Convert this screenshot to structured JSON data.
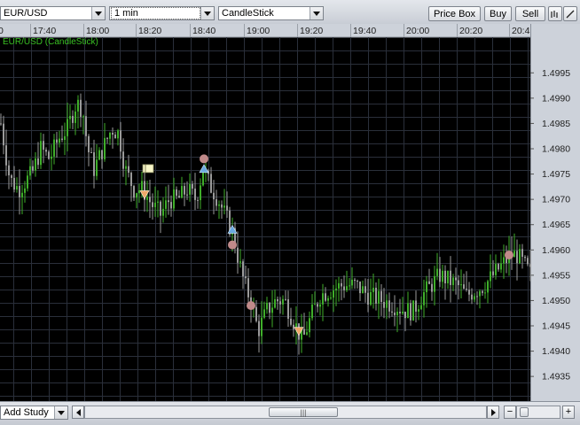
{
  "toolbar": {
    "symbol": "EUR/USD",
    "interval": "1 min",
    "chart_type": "CandleStick",
    "price_box_label": "Price Box",
    "buy_label": "Buy",
    "sell_label": "Sell"
  },
  "chart_title": "EUR/USD (CandleStick)",
  "bottom": {
    "add_study_label": "Add Study",
    "zoom_out_label": "−",
    "zoom_in_label": "+"
  },
  "colors": {
    "background": "#000000",
    "grid": "#2a2f3a",
    "bull": "#3fae2a",
    "bear": "#9a9a9a",
    "title": "#39c023",
    "marker_circle": "#c08a8a",
    "marker_up": "#6aa9e0",
    "marker_down": "#f0a86a",
    "axis_bg": "#cdd2da"
  },
  "chart_data": {
    "type": "candlestick",
    "title": "EUR/USD (CandleStick)",
    "x_ticks": [
      "0",
      "17:40",
      "18:00",
      "18:20",
      "18:40",
      "19:00",
      "19:20",
      "19:40",
      "20:00",
      "20:20",
      "20:4"
    ],
    "y_ticks": [
      "1.4995",
      "1.4990",
      "1.4985",
      "1.4980",
      "1.4975",
      "1.4970",
      "1.4965",
      "1.4960",
      "1.4955",
      "1.4950",
      "1.4945",
      "1.4940",
      "1.4935"
    ],
    "ylim": [
      1.4931,
      1.5001
    ],
    "grid": true,
    "price_path": [
      [
        0,
        1.4985
      ],
      [
        10,
        1.4974
      ],
      [
        20,
        1.4972
      ],
      [
        35,
        1.4975
      ],
      [
        45,
        1.498
      ],
      [
        55,
        1.4978
      ],
      [
        65,
        1.4982
      ],
      [
        75,
        1.4984
      ],
      [
        85,
        1.4989
      ],
      [
        92,
        1.4988
      ],
      [
        98,
        1.498
      ],
      [
        105,
        1.4976
      ],
      [
        115,
        1.498
      ],
      [
        125,
        1.4984
      ],
      [
        133,
        1.4983
      ],
      [
        140,
        1.4976
      ],
      [
        150,
        1.4972
      ],
      [
        160,
        1.4972
      ],
      [
        170,
        1.4969
      ],
      [
        180,
        1.4967
      ],
      [
        190,
        1.497
      ],
      [
        200,
        1.497
      ],
      [
        210,
        1.4972
      ],
      [
        220,
        1.497
      ],
      [
        228,
        1.4976
      ],
      [
        235,
        1.4973
      ],
      [
        245,
        1.497
      ],
      [
        255,
        1.4966
      ],
      [
        262,
        1.4963
      ],
      [
        268,
        1.4958
      ],
      [
        275,
        1.4953
      ],
      [
        282,
        1.495
      ],
      [
        290,
        1.4944
      ],
      [
        300,
        1.4948
      ],
      [
        310,
        1.495
      ],
      [
        320,
        1.495
      ],
      [
        330,
        1.4946
      ],
      [
        340,
        1.4942
      ],
      [
        350,
        1.4947
      ],
      [
        360,
        1.4951
      ],
      [
        370,
        1.4952
      ],
      [
        385,
        1.4953
      ],
      [
        400,
        1.4953
      ],
      [
        415,
        1.4951
      ],
      [
        430,
        1.495
      ],
      [
        445,
        1.4949
      ],
      [
        455,
        1.4948
      ],
      [
        465,
        1.4948
      ],
      [
        475,
        1.4951
      ],
      [
        485,
        1.4953
      ],
      [
        495,
        1.4955
      ],
      [
        505,
        1.4954
      ],
      [
        515,
        1.4953
      ],
      [
        525,
        1.4951
      ],
      [
        535,
        1.4952
      ],
      [
        545,
        1.4953
      ],
      [
        555,
        1.4955
      ],
      [
        565,
        1.4957
      ],
      [
        575,
        1.4959
      ],
      [
        582,
        1.4959
      ],
      [
        590,
        1.4957
      ],
      [
        598,
        1.4955
      ]
    ],
    "markers": [
      {
        "kind": "flag",
        "x": 167,
        "price": 1.4976
      },
      {
        "kind": "down",
        "x": 163,
        "price": 1.4971
      },
      {
        "kind": "circle",
        "x": 230,
        "price": 1.4978
      },
      {
        "kind": "up",
        "x": 230,
        "price": 1.4976
      },
      {
        "kind": "up",
        "x": 262,
        "price": 1.4964
      },
      {
        "kind": "circle",
        "x": 262,
        "price": 1.4961
      },
      {
        "kind": "circle",
        "x": 283,
        "price": 1.4949
      },
      {
        "kind": "down",
        "x": 337,
        "price": 1.4944
      },
      {
        "kind": "circle",
        "x": 574,
        "price": 1.4959
      }
    ]
  }
}
